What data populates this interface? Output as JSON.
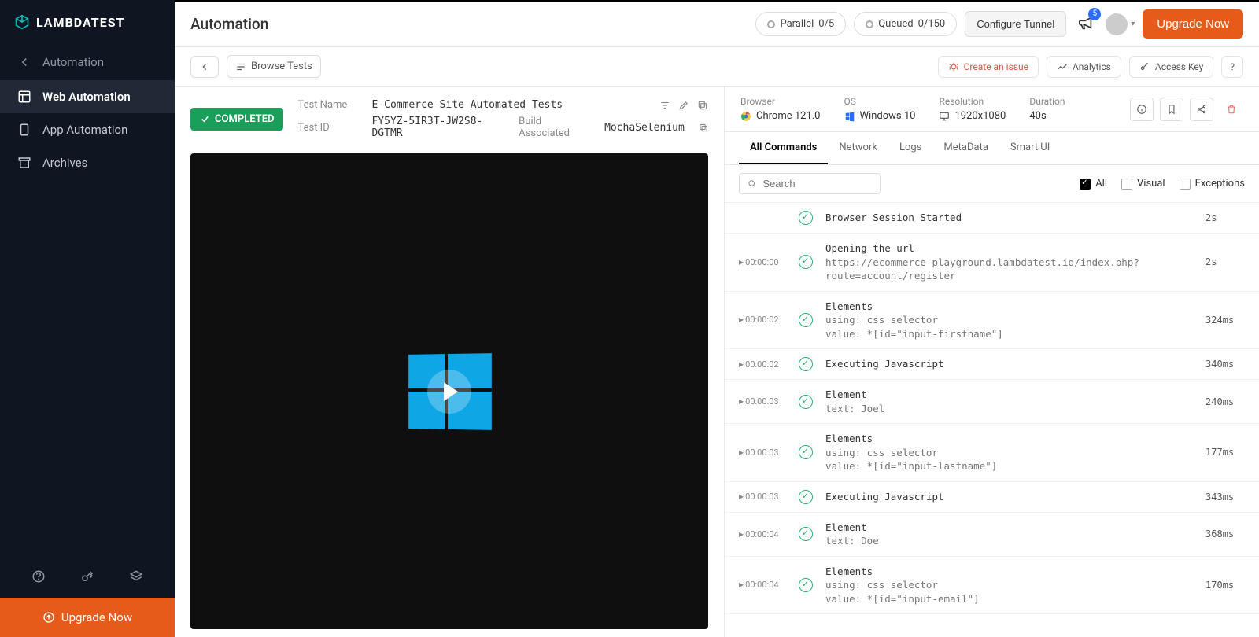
{
  "brand": "LAMBDATEST",
  "sidebar": {
    "group": "Automation",
    "items": [
      "Web Automation",
      "App Automation",
      "Archives"
    ],
    "upgrade": "Upgrade Now"
  },
  "header": {
    "title": "Automation",
    "parallel_label": "Parallel",
    "parallel_count": "0/5",
    "queued_label": "Queued",
    "queued_count": "0/150",
    "tunnel": "Configure Tunnel",
    "notif_badge": "5",
    "upgrade": "Upgrade Now"
  },
  "toolbar": {
    "browse": "Browse Tests",
    "create_issue": "Create an issue",
    "analytics": "Analytics",
    "access_key": "Access Key",
    "help": "?"
  },
  "test": {
    "status": "COMPLETED",
    "name_label": "Test Name",
    "name": "E-Commerce Site Automated Tests",
    "id_label": "Test ID",
    "id": "FY5YZ-5IR3T-JW2S8-DGTMR",
    "build_label": "Build Associated",
    "build": "MochaSelenium"
  },
  "env": {
    "browser_label": "Browser",
    "browser": "Chrome 121.0",
    "os_label": "OS",
    "os": "Windows 10",
    "res_label": "Resolution",
    "res": "1920x1080",
    "dur_label": "Duration",
    "dur": "40s"
  },
  "tabs": [
    "All Commands",
    "Network",
    "Logs",
    "MetaData",
    "Smart UI"
  ],
  "filters": {
    "search_placeholder": "Search",
    "all": "All",
    "visual": "Visual",
    "exceptions": "Exceptions"
  },
  "commands": [
    {
      "ts": "",
      "title": "Browser Session Started",
      "sub": "",
      "dur": "2s"
    },
    {
      "ts": "00:00:00",
      "title": "Opening the url",
      "sub": "https://ecommerce-playground.lambdatest.io/index.php?route=account/register",
      "dur": "2s"
    },
    {
      "ts": "00:00:02",
      "title": "Elements",
      "sub": "using: css selector\nvalue: *[id=\"input-firstname\"]",
      "dur": "324ms"
    },
    {
      "ts": "00:00:02",
      "title": "Executing Javascript",
      "sub": "",
      "dur": "340ms"
    },
    {
      "ts": "00:00:03",
      "title": "Element",
      "sub": "text: Joel",
      "dur": "240ms"
    },
    {
      "ts": "00:00:03",
      "title": "Elements",
      "sub": "using: css selector\nvalue: *[id=\"input-lastname\"]",
      "dur": "177ms"
    },
    {
      "ts": "00:00:03",
      "title": "Executing Javascript",
      "sub": "",
      "dur": "343ms"
    },
    {
      "ts": "00:00:04",
      "title": "Element",
      "sub": "text: Doe",
      "dur": "368ms"
    },
    {
      "ts": "00:00:04",
      "title": "Elements",
      "sub": "using: css selector\nvalue: *[id=\"input-email\"]",
      "dur": "170ms"
    }
  ]
}
